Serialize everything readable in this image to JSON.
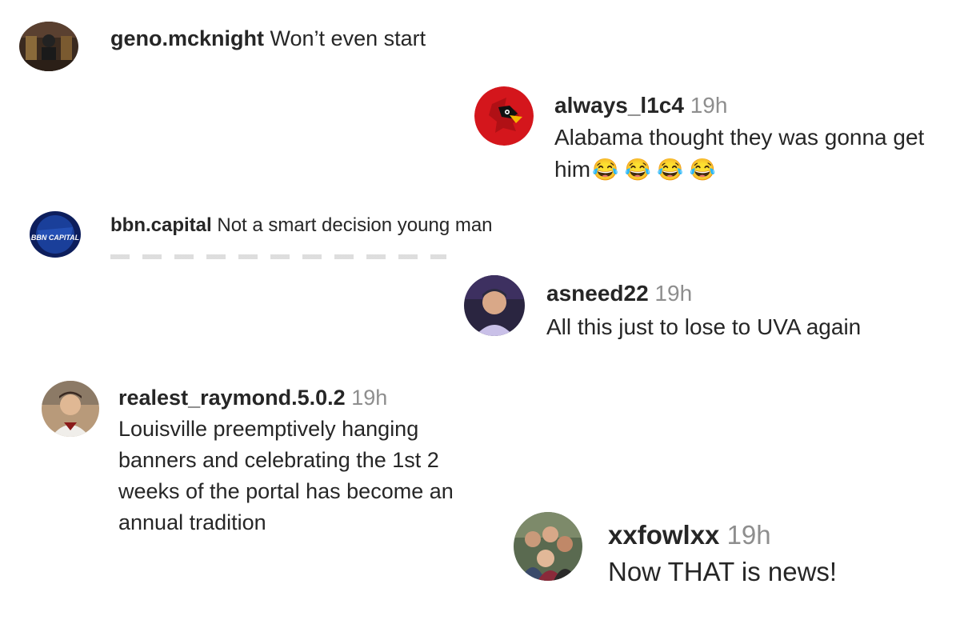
{
  "comments": [
    {
      "username": "geno.mcknight",
      "time": "",
      "text": "Won’t even start"
    },
    {
      "username": "always_l1c4",
      "time": "19h",
      "text": "Alabama thought they was gonna get him",
      "emoji": "😂 😂 😂 😂"
    },
    {
      "username": "bbn.capital",
      "time": "",
      "text": "Not a smart decision young man",
      "avatar_label": "BBN CAPITAL"
    },
    {
      "username": "asneed22",
      "time": "19h",
      "text": "All this just to lose to UVA again"
    },
    {
      "username": "realest_raymond.5.0.2",
      "time": "19h",
      "text": "Louisville preemptively hanging banners and celebrating the 1st 2 weeks of the portal has become an annual tradition"
    },
    {
      "username": "xxfowlxx",
      "time": "19h",
      "text": "Now THAT is news!"
    }
  ],
  "colors": {
    "text": "#262626",
    "muted": "#8e8e8e",
    "louisville_red": "#d4161c",
    "kentucky_blue": "#1a3f9a"
  }
}
